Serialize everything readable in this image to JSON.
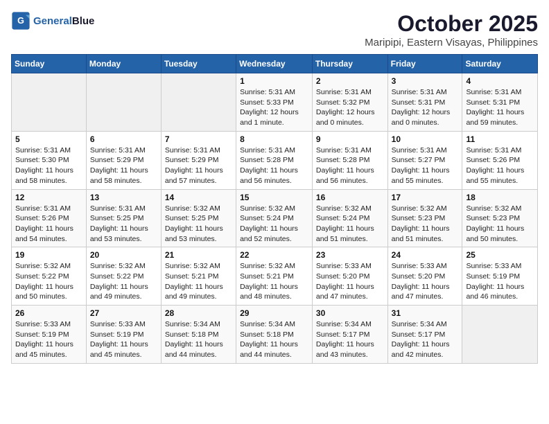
{
  "logo": {
    "line1": "General",
    "line2": "Blue"
  },
  "title": "October 2025",
  "location": "Maripipi, Eastern Visayas, Philippines",
  "weekdays": [
    "Sunday",
    "Monday",
    "Tuesday",
    "Wednesday",
    "Thursday",
    "Friday",
    "Saturday"
  ],
  "weeks": [
    [
      {
        "day": "",
        "info": ""
      },
      {
        "day": "",
        "info": ""
      },
      {
        "day": "",
        "info": ""
      },
      {
        "day": "1",
        "info": "Sunrise: 5:31 AM\nSunset: 5:33 PM\nDaylight: 12 hours\nand 1 minute."
      },
      {
        "day": "2",
        "info": "Sunrise: 5:31 AM\nSunset: 5:32 PM\nDaylight: 12 hours\nand 0 minutes."
      },
      {
        "day": "3",
        "info": "Sunrise: 5:31 AM\nSunset: 5:31 PM\nDaylight: 12 hours\nand 0 minutes."
      },
      {
        "day": "4",
        "info": "Sunrise: 5:31 AM\nSunset: 5:31 PM\nDaylight: 11 hours\nand 59 minutes."
      }
    ],
    [
      {
        "day": "5",
        "info": "Sunrise: 5:31 AM\nSunset: 5:30 PM\nDaylight: 11 hours\nand 58 minutes."
      },
      {
        "day": "6",
        "info": "Sunrise: 5:31 AM\nSunset: 5:29 PM\nDaylight: 11 hours\nand 58 minutes."
      },
      {
        "day": "7",
        "info": "Sunrise: 5:31 AM\nSunset: 5:29 PM\nDaylight: 11 hours\nand 57 minutes."
      },
      {
        "day": "8",
        "info": "Sunrise: 5:31 AM\nSunset: 5:28 PM\nDaylight: 11 hours\nand 56 minutes."
      },
      {
        "day": "9",
        "info": "Sunrise: 5:31 AM\nSunset: 5:28 PM\nDaylight: 11 hours\nand 56 minutes."
      },
      {
        "day": "10",
        "info": "Sunrise: 5:31 AM\nSunset: 5:27 PM\nDaylight: 11 hours\nand 55 minutes."
      },
      {
        "day": "11",
        "info": "Sunrise: 5:31 AM\nSunset: 5:26 PM\nDaylight: 11 hours\nand 55 minutes."
      }
    ],
    [
      {
        "day": "12",
        "info": "Sunrise: 5:31 AM\nSunset: 5:26 PM\nDaylight: 11 hours\nand 54 minutes."
      },
      {
        "day": "13",
        "info": "Sunrise: 5:31 AM\nSunset: 5:25 PM\nDaylight: 11 hours\nand 53 minutes."
      },
      {
        "day": "14",
        "info": "Sunrise: 5:32 AM\nSunset: 5:25 PM\nDaylight: 11 hours\nand 53 minutes."
      },
      {
        "day": "15",
        "info": "Sunrise: 5:32 AM\nSunset: 5:24 PM\nDaylight: 11 hours\nand 52 minutes."
      },
      {
        "day": "16",
        "info": "Sunrise: 5:32 AM\nSunset: 5:24 PM\nDaylight: 11 hours\nand 51 minutes."
      },
      {
        "day": "17",
        "info": "Sunrise: 5:32 AM\nSunset: 5:23 PM\nDaylight: 11 hours\nand 51 minutes."
      },
      {
        "day": "18",
        "info": "Sunrise: 5:32 AM\nSunset: 5:23 PM\nDaylight: 11 hours\nand 50 minutes."
      }
    ],
    [
      {
        "day": "19",
        "info": "Sunrise: 5:32 AM\nSunset: 5:22 PM\nDaylight: 11 hours\nand 50 minutes."
      },
      {
        "day": "20",
        "info": "Sunrise: 5:32 AM\nSunset: 5:22 PM\nDaylight: 11 hours\nand 49 minutes."
      },
      {
        "day": "21",
        "info": "Sunrise: 5:32 AM\nSunset: 5:21 PM\nDaylight: 11 hours\nand 49 minutes."
      },
      {
        "day": "22",
        "info": "Sunrise: 5:32 AM\nSunset: 5:21 PM\nDaylight: 11 hours\nand 48 minutes."
      },
      {
        "day": "23",
        "info": "Sunrise: 5:33 AM\nSunset: 5:20 PM\nDaylight: 11 hours\nand 47 minutes."
      },
      {
        "day": "24",
        "info": "Sunrise: 5:33 AM\nSunset: 5:20 PM\nDaylight: 11 hours\nand 47 minutes."
      },
      {
        "day": "25",
        "info": "Sunrise: 5:33 AM\nSunset: 5:19 PM\nDaylight: 11 hours\nand 46 minutes."
      }
    ],
    [
      {
        "day": "26",
        "info": "Sunrise: 5:33 AM\nSunset: 5:19 PM\nDaylight: 11 hours\nand 45 minutes."
      },
      {
        "day": "27",
        "info": "Sunrise: 5:33 AM\nSunset: 5:19 PM\nDaylight: 11 hours\nand 45 minutes."
      },
      {
        "day": "28",
        "info": "Sunrise: 5:34 AM\nSunset: 5:18 PM\nDaylight: 11 hours\nand 44 minutes."
      },
      {
        "day": "29",
        "info": "Sunrise: 5:34 AM\nSunset: 5:18 PM\nDaylight: 11 hours\nand 44 minutes."
      },
      {
        "day": "30",
        "info": "Sunrise: 5:34 AM\nSunset: 5:17 PM\nDaylight: 11 hours\nand 43 minutes."
      },
      {
        "day": "31",
        "info": "Sunrise: 5:34 AM\nSunset: 5:17 PM\nDaylight: 11 hours\nand 42 minutes."
      },
      {
        "day": "",
        "info": ""
      }
    ]
  ]
}
